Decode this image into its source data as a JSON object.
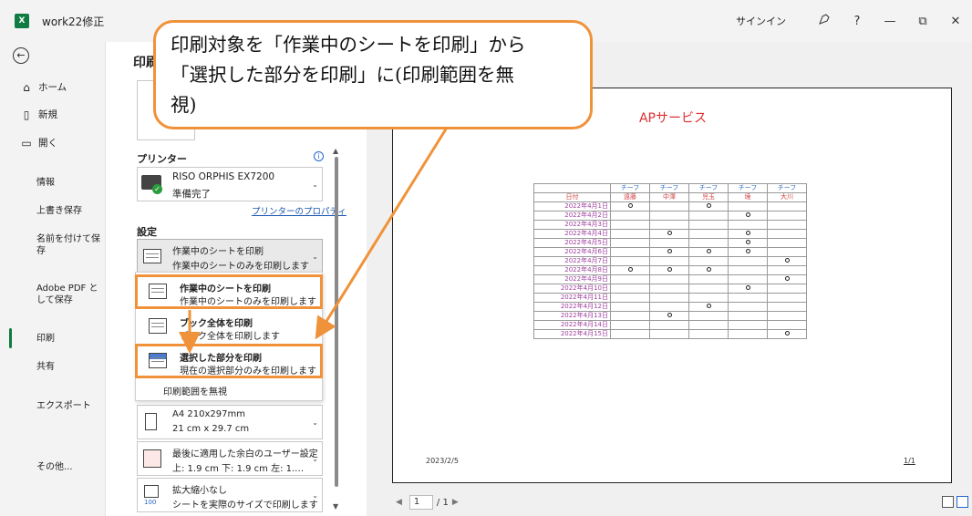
{
  "window": {
    "title": "work22修正",
    "app_logo": "X",
    "signin": "サインイン",
    "icons": [
      "coauthor-icon",
      "help-icon",
      "minimize-icon",
      "restore-icon",
      "close-icon"
    ],
    "help_label": "?",
    "minimize_label": "—",
    "restore_label": "⧉",
    "close_label": "✕"
  },
  "nav": {
    "back_icon": "←",
    "items": [
      {
        "label": "ホーム",
        "icon": "home-icon"
      },
      {
        "label": "新規",
        "icon": "new-document-icon"
      },
      {
        "label": "開く",
        "icon": "open-folder-icon"
      }
    ],
    "sub_items": [
      "情報",
      "上書き保存",
      "名前を付けて保存",
      "Adobe PDF として保存",
      "印刷",
      "共有",
      "エクスポート",
      "その他..."
    ],
    "active": "印刷"
  },
  "print_panel": {
    "heading": "印刷",
    "printer_label": "プリンター",
    "printer_name": "RISO ORPHIS EX7200",
    "printer_status": "準備完了",
    "printer_properties": "プリンターのプロパティ",
    "settings_label": "設定",
    "current_scope": {
      "title": "作業中のシートを印刷",
      "desc": "作業中のシートのみを印刷します"
    },
    "menu": [
      {
        "title": "作業中のシートを印刷",
        "desc": "作業中のシートのみを印刷します"
      },
      {
        "title": "ブック全体を印刷",
        "desc": "ブック全体を印刷します"
      },
      {
        "title": "選択した部分を印刷",
        "desc": "現在の選択部分のみを印刷します"
      }
    ],
    "ignore_print_area": "印刷範囲を無視",
    "paper": {
      "title": "A4 210x297mm",
      "desc": "21 cm x 29.7 cm"
    },
    "margins": {
      "title": "最後に適用した余白のユーザー設定",
      "desc": "上: 1.9 cm 下: 1.9 cm 左: 1.…"
    },
    "scaling": {
      "title": "拡大縮小なし",
      "desc": "シートを実際のサイズで印刷します"
    }
  },
  "preview": {
    "sheet_title": "APサービス",
    "team_header": [
      "チーフ",
      "チーフ",
      "チーフ",
      "チーフ",
      "チーフ"
    ],
    "date_header": "日付",
    "names": [
      "遠藤",
      "中澤",
      "児玉",
      "境",
      "大川"
    ],
    "rows": [
      {
        "date": "2022年4月1日",
        "marks": [
          1,
          0,
          1,
          0,
          0
        ]
      },
      {
        "date": "2022年4月2日",
        "marks": [
          0,
          0,
          0,
          1,
          0
        ]
      },
      {
        "date": "2022年4月3日",
        "marks": [
          0,
          0,
          0,
          0,
          0
        ]
      },
      {
        "date": "2022年4月4日",
        "marks": [
          0,
          1,
          0,
          1,
          0
        ]
      },
      {
        "date": "2022年4月5日",
        "marks": [
          0,
          0,
          0,
          1,
          0
        ]
      },
      {
        "date": "2022年4月6日",
        "marks": [
          0,
          1,
          1,
          1,
          0
        ]
      },
      {
        "date": "2022年4月7日",
        "marks": [
          0,
          0,
          0,
          0,
          1
        ]
      },
      {
        "date": "2022年4月8日",
        "marks": [
          1,
          1,
          1,
          0,
          0
        ]
      },
      {
        "date": "2022年4月9日",
        "marks": [
          0,
          0,
          0,
          0,
          1
        ]
      },
      {
        "date": "2022年4月10日",
        "marks": [
          0,
          0,
          0,
          1,
          0
        ]
      },
      {
        "date": "2022年4月11日",
        "marks": [
          0,
          0,
          0,
          0,
          0
        ]
      },
      {
        "date": "2022年4月12日",
        "marks": [
          0,
          0,
          1,
          0,
          0
        ]
      },
      {
        "date": "2022年4月13日",
        "marks": [
          0,
          1,
          0,
          0,
          0
        ]
      },
      {
        "date": "2022年4月14日",
        "marks": [
          0,
          0,
          0,
          0,
          0
        ]
      },
      {
        "date": "2022年4月15日",
        "marks": [
          0,
          0,
          0,
          0,
          1
        ]
      }
    ],
    "footer_date": "2023/2/5",
    "footer_page": "1/1",
    "current_page": "1",
    "total_pages": "/ 1"
  },
  "callout": {
    "text_line1": "印刷対象を「作業中のシートを印刷」から",
    "text_line2": "「選択した部分を印刷」に(印刷範囲を無",
    "text_line3": "視)",
    "color": "#f0923a"
  }
}
